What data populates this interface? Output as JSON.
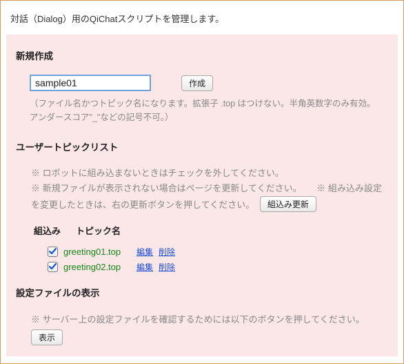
{
  "top_description": "対話（Dialog）用のQiChatスクリプトを管理します。",
  "create": {
    "title": "新規作成",
    "input_value": "sample01",
    "button": "作成",
    "hint": "（ファイル名かつトピック名になります。拡張子 .top はつけない。半角英数字のみ有効。アンダースコア\"_\"などの記号不可。）"
  },
  "topic_list": {
    "title": "ユーザートピックリスト",
    "note1": "※ ロボットに組み込まないときはチェックを外してください。",
    "note2a": "※ 新規ファイルが表示されない場合はページを更新してください。",
    "note2b": "※ 組み込み設定を変更したときは、右の更新ボタンを押してください。",
    "refresh_button": "組込み更新",
    "col_embed": "組込み",
    "col_name": "トピック名",
    "rows": [
      {
        "name": "greeting01.top",
        "edit": "編集",
        "delete": "削除",
        "checked": true
      },
      {
        "name": "greeting02.top",
        "edit": "編集",
        "delete": "削除",
        "checked": true
      }
    ]
  },
  "settings": {
    "title": "設定ファイルの表示",
    "note": "※ サーバー上の設定ファイルを確認するためには以下のボタンを押してください。",
    "show_button": "表示"
  }
}
